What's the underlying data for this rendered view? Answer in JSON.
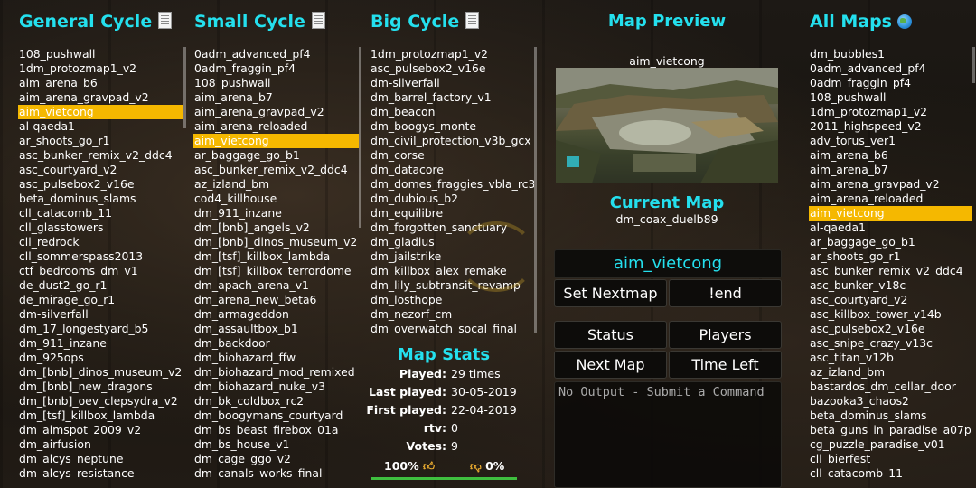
{
  "colors": {
    "accent": "#24e0ee",
    "selected": "#f5b800",
    "vote_bar": "#3fbf3f"
  },
  "general_cycle": {
    "title": "General Cycle",
    "icon": "page-icon",
    "selected_index": 4,
    "items": [
      "108_pushwall",
      "1dm_protozmap1_v2",
      "aim_arena_b6",
      "aim_arena_gravpad_v2",
      "aim_vietcong",
      "al-qaeda1",
      "ar_shoots_go_r1",
      "asc_bunker_remix_v2_ddc4",
      "asc_courtyard_v2",
      "asc_pulsebox2_v16e",
      "beta_dominus_slams",
      "cll_catacomb_11",
      "cll_glasstowers",
      "cll_redrock",
      "cll_sommerspass2013",
      "ctf_bedrooms_dm_v1",
      "de_dust2_go_r1",
      "de_mirage_go_r1",
      "dm-silverfall",
      "dm_17_longestyard_b5",
      "dm_911_inzane",
      "dm_925ops",
      "dm_[bnb]_dinos_museum_v2",
      "dm_[bnb]_new_dragons",
      "dm_[bnb]_oev_clepsydra_v2",
      "dm_[tsf]_killbox_lambda",
      "dm_aimspot_2009_v2",
      "dm_airfusion",
      "dm_alcys_neptune",
      "dm_alcys_resistance"
    ]
  },
  "small_cycle": {
    "title": "Small Cycle",
    "icon": "page-icon",
    "selected_index": 6,
    "items": [
      "0adm_advanced_pf4",
      "0adm_fraggin_pf4",
      "108_pushwall",
      "aim_arena_b7",
      "aim_arena_gravpad_v2",
      "aim_arena_reloaded",
      "aim_vietcong",
      "ar_baggage_go_b1",
      "asc_bunker_remix_v2_ddc4",
      "az_izland_bm",
      "cod4_killhouse",
      "dm_911_inzane",
      "dm_[bnb]_angels_v2",
      "dm_[bnb]_dinos_museum_v2",
      "dm_[tsf]_killbox_lambda",
      "dm_[tsf]_killbox_terrordome",
      "dm_apach_arena_v1",
      "dm_arena_new_beta6",
      "dm_armageddon",
      "dm_assaultbox_b1",
      "dm_backdoor",
      "dm_biohazard_ffw",
      "dm_biohazard_mod_remixed",
      "dm_biohazard_nuke_v3",
      "dm_bk_coldbox_rc2",
      "dm_boogymans_courtyard",
      "dm_bs_beast_firebox_01a",
      "dm_bs_house_v1",
      "dm_cage_ggo_v2",
      "dm_canals_works_final"
    ]
  },
  "big_cycle": {
    "title": "Big Cycle",
    "icon": "page-icon",
    "items": [
      "1dm_protozmap1_v2",
      "asc_pulsebox2_v16e",
      "dm-silverfall",
      "dm_barrel_factory_v1",
      "dm_beacon",
      "dm_boogys_monte",
      "dm_civil_protection_v3b_gcx",
      "dm_corse",
      "dm_datacore",
      "dm_domes_fraggies_vbla_rc3",
      "dm_dubious_b2",
      "dm_equilibre",
      "dm_forgotten_sanctuary",
      "dm_gladius",
      "dm_jailstrike",
      "dm_killbox_alex_remake",
      "dm_lily_subtransit_revamp",
      "dm_losthope",
      "dm_nezorf_cm",
      "dm_overwatch_socal_final"
    ]
  },
  "map_preview": {
    "title": "Map Preview",
    "map_name": "aim_vietcong"
  },
  "current_map": {
    "title": "Current Map",
    "map_name": "dm_coax_duelb89"
  },
  "map_input": {
    "value": "aim_vietcong"
  },
  "buttons": {
    "set_nextmap": "Set Nextmap",
    "end": "!end",
    "status": "Status",
    "players": "Players",
    "next_map": "Next Map",
    "time_left": "Time Left"
  },
  "console": {
    "placeholder": "No Output - Submit a Command"
  },
  "map_stats": {
    "title": "Map Stats",
    "rows": [
      {
        "label": "Played:",
        "value": "29 times"
      },
      {
        "label": "Last played:",
        "value": "30-05-2019"
      },
      {
        "label": "First played:",
        "value": "22-04-2019"
      },
      {
        "label": "rtv:",
        "value": "0"
      },
      {
        "label": "Votes:",
        "value": "9"
      }
    ],
    "upvote_pct": "100%",
    "upvote_icon": "thumbs-up-icon",
    "downvote_pct": "0%",
    "downvote_icon": "thumbs-down-icon",
    "vote_fraction": 1.0
  },
  "all_maps": {
    "title": "All Maps",
    "icon": "globe-icon",
    "selected_index": 11,
    "items": [
      "dm_bubbles1",
      "0adm_advanced_pf4",
      "0adm_fraggin_pf4",
      "108_pushwall",
      "1dm_protozmap1_v2",
      "2011_highspeed_v2",
      "adv_torus_ver1",
      "aim_arena_b6",
      "aim_arena_b7",
      "aim_arena_gravpad_v2",
      "aim_arena_reloaded",
      "aim_vietcong",
      "al-qaeda1",
      "ar_baggage_go_b1",
      "ar_shoots_go_r1",
      "asc_bunker_remix_v2_ddc4",
      "asc_bunker_v18c",
      "asc_courtyard_v2",
      "asc_killbox_tower_v14b",
      "asc_pulsebox2_v16e",
      "asc_snipe_crazy_v13c",
      "asc_titan_v12b",
      "az_izland_bm",
      "bastardos_dm_cellar_door",
      "bazooka3_chaos2",
      "beta_dominus_slams",
      "beta_guns_in_paradise_a07p",
      "cg_puzzle_paradise_v01",
      "cll_bierfest",
      "cll_catacomb_11"
    ]
  }
}
